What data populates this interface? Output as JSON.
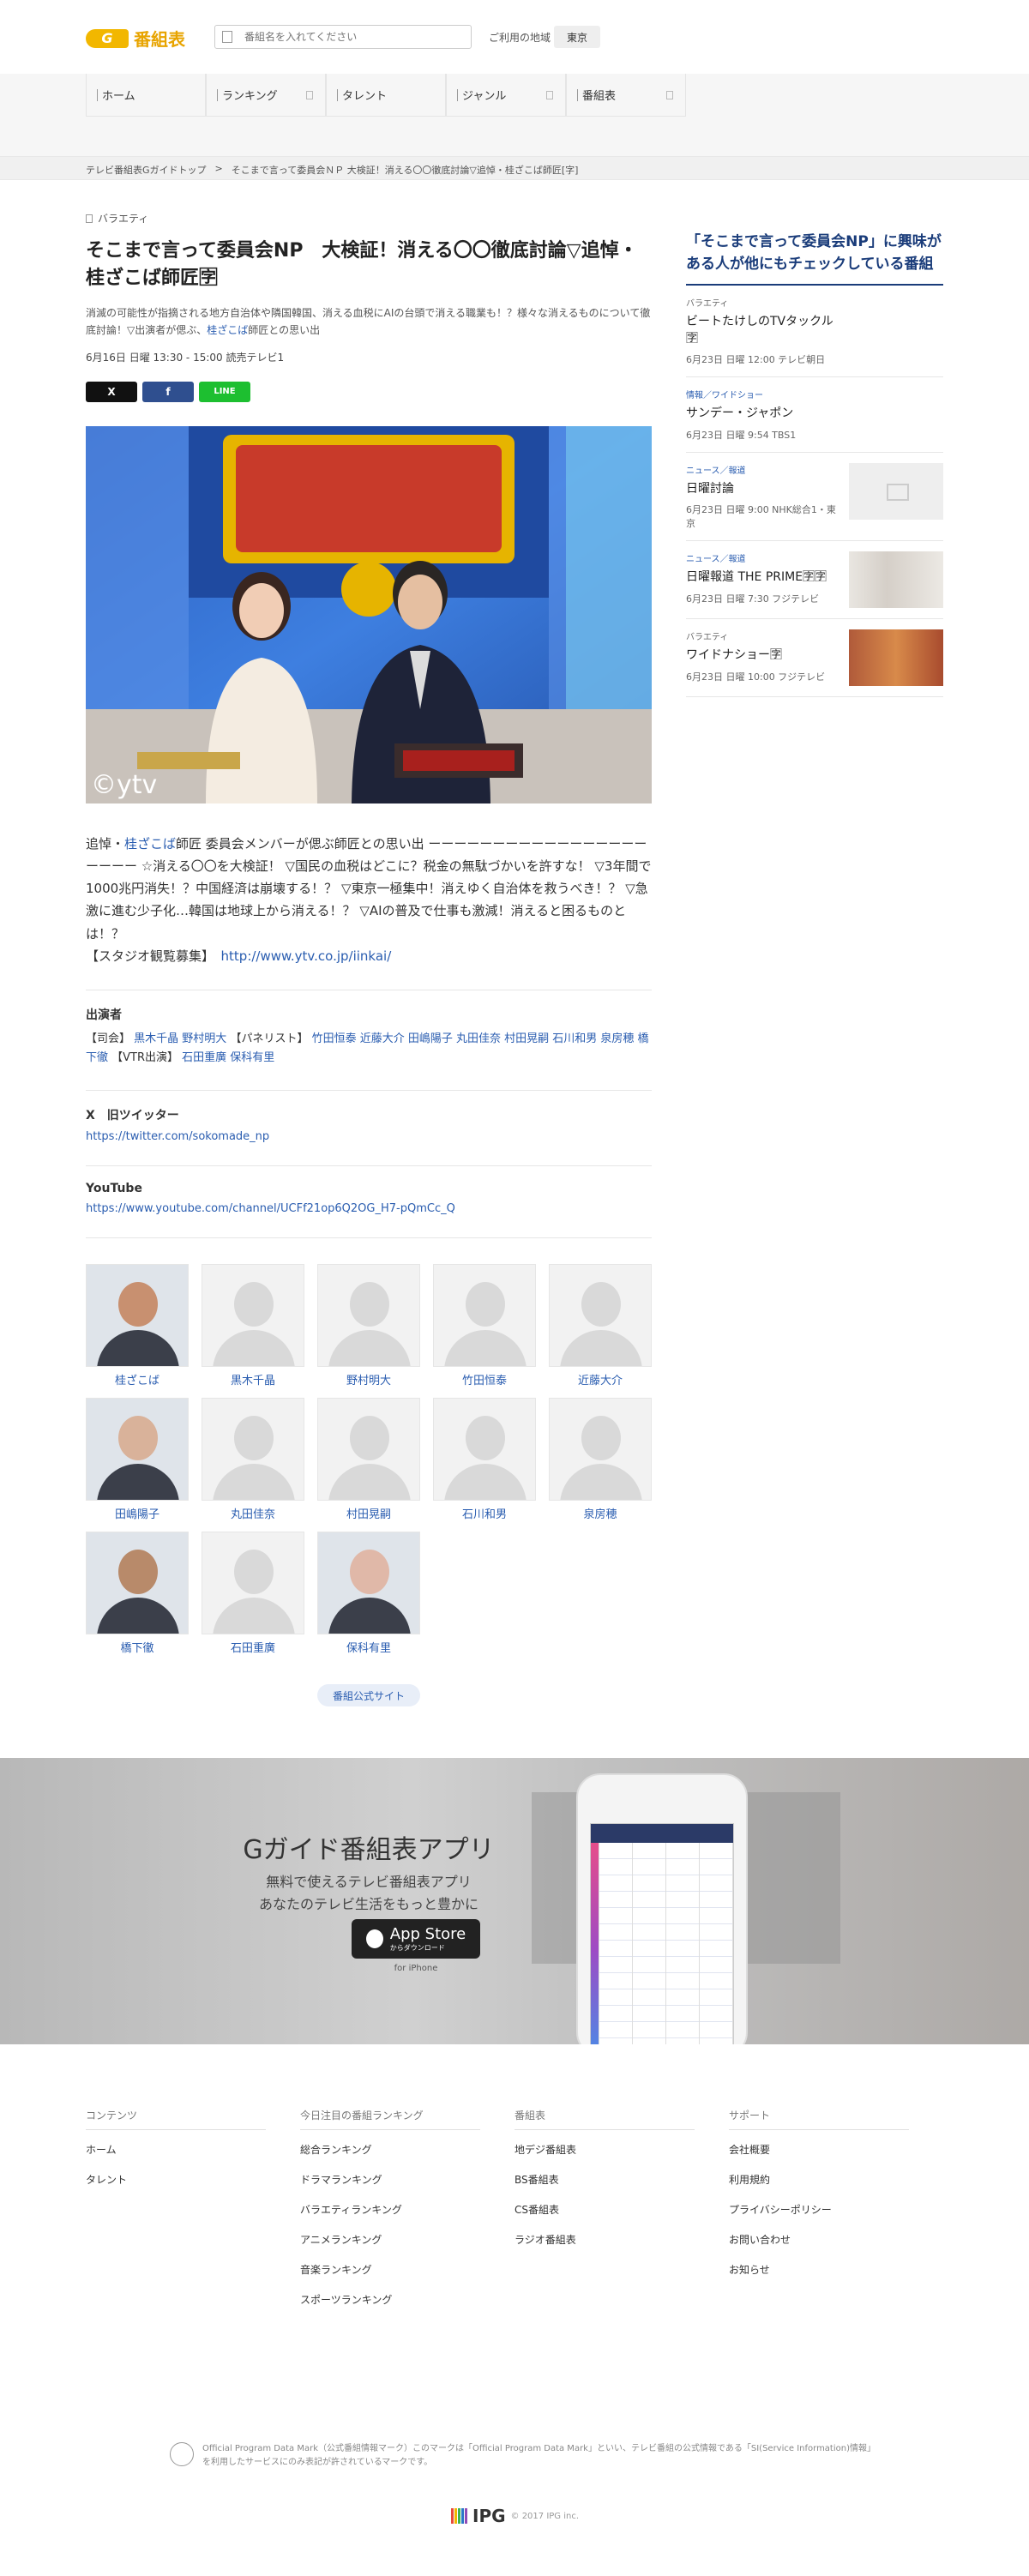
{
  "header": {
    "logo_badge": "G",
    "logo_text": "番組表",
    "search_placeholder": "番組名を入れてください",
    "region_label": "ご利用の地域",
    "region_value": "東京"
  },
  "nav": [
    {
      "label": "ホーム"
    },
    {
      "label": "ランキング"
    },
    {
      "label": "タレント"
    },
    {
      "label": "ジャンル"
    },
    {
      "label": "番組表"
    }
  ],
  "breadcrumb": [
    "テレビ番組表Gガイドトップ",
    ">",
    "そこまで言って委員会ＮＰ 大検証！消える〇〇徹底討論▽追悼・桂ざこば師匠[字]"
  ],
  "program": {
    "genre": "バラエティ",
    "title": "そこまで言って委員会NP　大検証！消える〇〇徹底討論▽追悼・桂ざこば師匠🈑",
    "subtitle_pre": "消滅の可能性が指摘される地方自治体や隣国韓国、消える血税にAIの台頭で消える職業も！？様々な消えるものについて徹底討論！▽出演者が偲ぶ、",
    "subtitle_link": "桂ざこば",
    "subtitle_post": "師匠との思い出",
    "airtime": "6月16日 日曜 13:30 - 15:00 読売テレビ1",
    "share_x": "X",
    "share_fb": "f",
    "share_line": "LINE",
    "image_credit": "©ytv",
    "desc_pre": "追悼・",
    "desc_link": "桂ざこば",
    "desc_body": "師匠 委員会メンバーが偲ぶ師匠との思い出 ーーーーーーーーーーーーーーーーーーーーー ☆消える〇〇を大検証！ ▽国民の血税はどこに？税金の無駄づかいを許すな！ ▽3年間で1000兆円消失！？中国経済は崩壊する！？ ▽東京一極集中！消えゆく自治体を救うべき！？ ▽急激に進む少子化…韓国は地球上から消える！？ ▽AIの普及で仕事も激減！消えると困るものとは！？",
    "desc_studio": "【スタジオ観覧募集】",
    "desc_url": "http://www.ytv.co.jp/iinkai/"
  },
  "cast": {
    "heading": "出演者",
    "host_label": "【司会】",
    "hosts": "黒木千晶 野村明大",
    "panel_label": "【パネリスト】",
    "panel": "竹田恒泰 近藤大介 田嶋陽子 丸田佳奈 村田晃嗣 石川和男 泉房穂 橋下徹",
    "vtr_label": "【VTR出演】",
    "vtr": "石田重廣 保科有里"
  },
  "twitter": {
    "heading": "X　旧ツイッター",
    "url": "https://twitter.com/sokomade_np"
  },
  "youtube": {
    "heading": "YouTube",
    "url": "https://www.youtube.com/channel/UCFf21op6Q2OG_H7-pQmCc_Q"
  },
  "talents": [
    {
      "name": "桂ざこば",
      "photo": true
    },
    {
      "name": "黒木千晶",
      "photo": false
    },
    {
      "name": "野村明大",
      "photo": false
    },
    {
      "name": "竹田恒泰",
      "photo": false
    },
    {
      "name": "近藤大介",
      "photo": false
    },
    {
      "name": "田嶋陽子",
      "photo": true
    },
    {
      "name": "丸田佳奈",
      "photo": false
    },
    {
      "name": "村田晃嗣",
      "photo": false
    },
    {
      "name": "石川和男",
      "photo": false
    },
    {
      "name": "泉房穂",
      "photo": false
    },
    {
      "name": "橋下徹",
      "photo": true
    },
    {
      "name": "石田重廣",
      "photo": false
    },
    {
      "name": "保科有里",
      "photo": true
    }
  ],
  "official_site": "番組公式サイト",
  "sidebar": {
    "title": "「そこまで言って委員会NP」に興味がある人が他にもチェックしている番組",
    "items": [
      {
        "genre": "バラエティ",
        "title": "ビートたけしのTVタックル🈑",
        "meta": "6月23日 日曜 12:00 テレビ朝日",
        "thumb": "none"
      },
      {
        "genre": "情報／ワイドショー",
        "title": "サンデー・ジャポン",
        "meta": "6月23日 日曜 9:54 TBS1",
        "thumb": "none"
      },
      {
        "genre": "ニュース／報道",
        "title": "日曜討論",
        "meta": "6月23日 日曜 9:00 NHK総合1・東京",
        "thumb": "placeholder"
      },
      {
        "genre": "ニュース／報道",
        "title": "日曜報道 THE PRIME🈑🈑",
        "meta": "6月23日 日曜 7:30 フジテレビ",
        "thumb": "photo"
      },
      {
        "genre": "バラエティ",
        "title": "ワイドナショー🈑",
        "meta": "6月23日 日曜 10:00 フジテレビ",
        "thumb": "photo2"
      }
    ]
  },
  "app": {
    "title": "Gガイド番組表アプリ",
    "sub1": "無料で使えるテレビ番組表アプリ",
    "sub2": "あなたのテレビ生活をもっと豊かに",
    "store_small": "からダウンロード",
    "store_big": "App Store",
    "for": "for iPhone"
  },
  "footer": {
    "cols": [
      {
        "heading": "コンテンツ",
        "items": [
          "ホーム",
          "タレント"
        ]
      },
      {
        "heading": "今日注目の番組ランキング",
        "items": [
          "総合ランキング",
          "ドラマランキング",
          "バラエティランキング",
          "アニメランキング",
          "音楽ランキング",
          "スポーツランキング"
        ]
      },
      {
        "heading": "番組表",
        "items": [
          "地デジ番組表",
          "BS番組表",
          "CS番組表",
          "ラジオ番組表"
        ]
      },
      {
        "heading": "サポート",
        "items": [
          "会社概要",
          "利用規約",
          "プライバシーポリシー",
          "お問い合わせ",
          "お知らせ"
        ]
      }
    ],
    "notice": "Official Program Data Mark（公式番組情報マーク）このマークは「Official Program Data Mark」といい、テレビ番組の公式情報である「SI(Service Information)情報」を利用したサービスにのみ表記が許されているマークです。",
    "ipg_name": "IPG",
    "copyright": "© 2017 IPG inc."
  },
  "colors": {
    "accent_yellow": "#f2b700",
    "link_blue": "#2a5db0",
    "sidebar_navy": "#1a3c7a",
    "line_green": "#1dbf30"
  }
}
